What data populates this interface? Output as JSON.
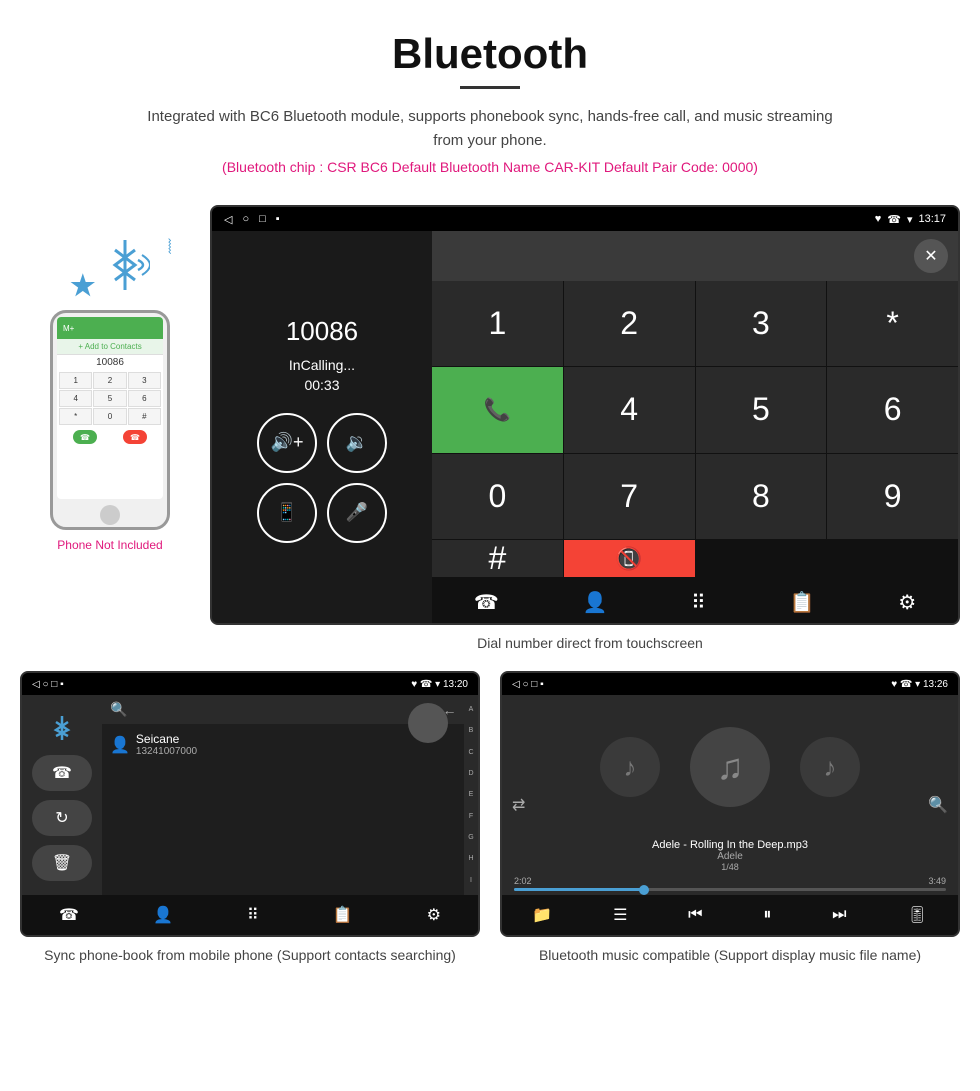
{
  "header": {
    "title": "Bluetooth",
    "description": "Integrated with BC6 Bluetooth module, supports phonebook sync, hands-free call, and music streaming from your phone.",
    "specs": "(Bluetooth chip : CSR BC6    Default Bluetooth Name CAR-KIT    Default Pair Code: 0000)"
  },
  "phone_label": "Phone Not Included",
  "dial_screen": {
    "status_left": "◁  ○  □  ▪",
    "status_right": "♥  ☎  ▾  13:17",
    "number": "10086",
    "status": "InCalling...",
    "timer": "00:33",
    "keypad": [
      "1",
      "2",
      "3",
      "*",
      "4",
      "5",
      "6",
      "0",
      "7",
      "8",
      "9",
      "#"
    ],
    "caption": "Dial number direct from touchscreen"
  },
  "phonebook_screen": {
    "status_left": "◁  ○  □  ▪",
    "status_right": "♥  ☎  ▾  13:20",
    "contact_name": "Seicane",
    "contact_number": "13241007000",
    "alpha": [
      "A",
      "B",
      "C",
      "D",
      "E",
      "F",
      "G",
      "H",
      "I"
    ],
    "caption": "Sync phone-book from mobile phone\n(Support contacts searching)"
  },
  "music_screen": {
    "status_left": "◁  ○  □  ▪",
    "status_right": "♥  ☎  ▾  13:26",
    "song_title": "Adele - Rolling In the Deep.mp3",
    "artist": "Adele",
    "track": "1/48",
    "time_current": "2:02",
    "time_total": "3:49",
    "caption": "Bluetooth music compatible\n(Support display music file name)"
  }
}
